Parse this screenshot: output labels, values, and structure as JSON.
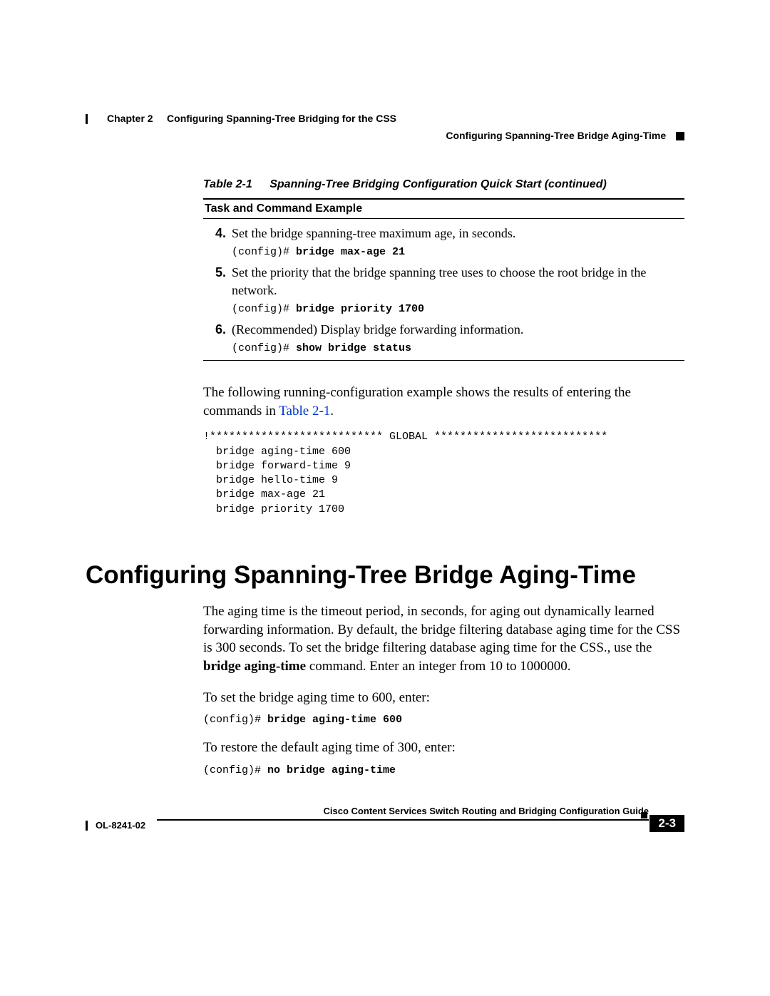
{
  "header": {
    "chapter_label": "Chapter 2",
    "chapter_title": "Configuring Spanning-Tree Bridging for the CSS",
    "section_title": "Configuring Spanning-Tree Bridge Aging-Time"
  },
  "table": {
    "caption_label": "Table 2-1",
    "caption_text": "Spanning-Tree Bridging Configuration Quick Start (continued)",
    "header": "Task and Command Example",
    "steps": [
      {
        "num": "4.",
        "text": "Set the bridge spanning-tree maximum age, in seconds.",
        "prompt": "(config)# ",
        "cmd": "bridge max-age 21"
      },
      {
        "num": "5.",
        "text": "Set the priority that the bridge spanning tree uses to choose the root bridge in the network.",
        "prompt": "(config)# ",
        "cmd": "bridge priority 1700"
      },
      {
        "num": "6.",
        "text": "(Recommended) Display bridge forwarding information.",
        "prompt": "(config)# ",
        "cmd": "show bridge status"
      }
    ]
  },
  "para1_a": "The following running-configuration example shows the results of entering the commands in ",
  "para1_link": "Table 2-1",
  "para1_b": ".",
  "code_block": "!*************************** GLOBAL ***************************\n  bridge aging-time 600\n  bridge forward-time 9\n  bridge hello-time 9\n  bridge max-age 21\n  bridge priority 1700",
  "h1": "Configuring Spanning-Tree Bridge Aging-Time",
  "body": {
    "p1_a": "The aging time is the timeout period, in seconds, for aging out dynamically learned forwarding information. By default, the bridge filtering database aging time for the CSS is 300 seconds.  To set the bridge filtering database aging time for the CSS., use the ",
    "p1_cmd": "bridge aging-time",
    "p1_b": " command.  Enter an integer from 10 to 1000000.",
    "p2": "To set the bridge aging time to 600, enter:",
    "c2_prompt": "(config)# ",
    "c2_cmd": "bridge aging-time 600",
    "p3": "To restore the default aging time of 300, enter:",
    "c3_prompt": "(config)# ",
    "c3_cmd": "no bridge aging-time"
  },
  "footer": {
    "guide": "Cisco Content Services Switch Routing and Bridging Configuration Guide",
    "doc": "OL-8241-02",
    "page": "2-3"
  }
}
